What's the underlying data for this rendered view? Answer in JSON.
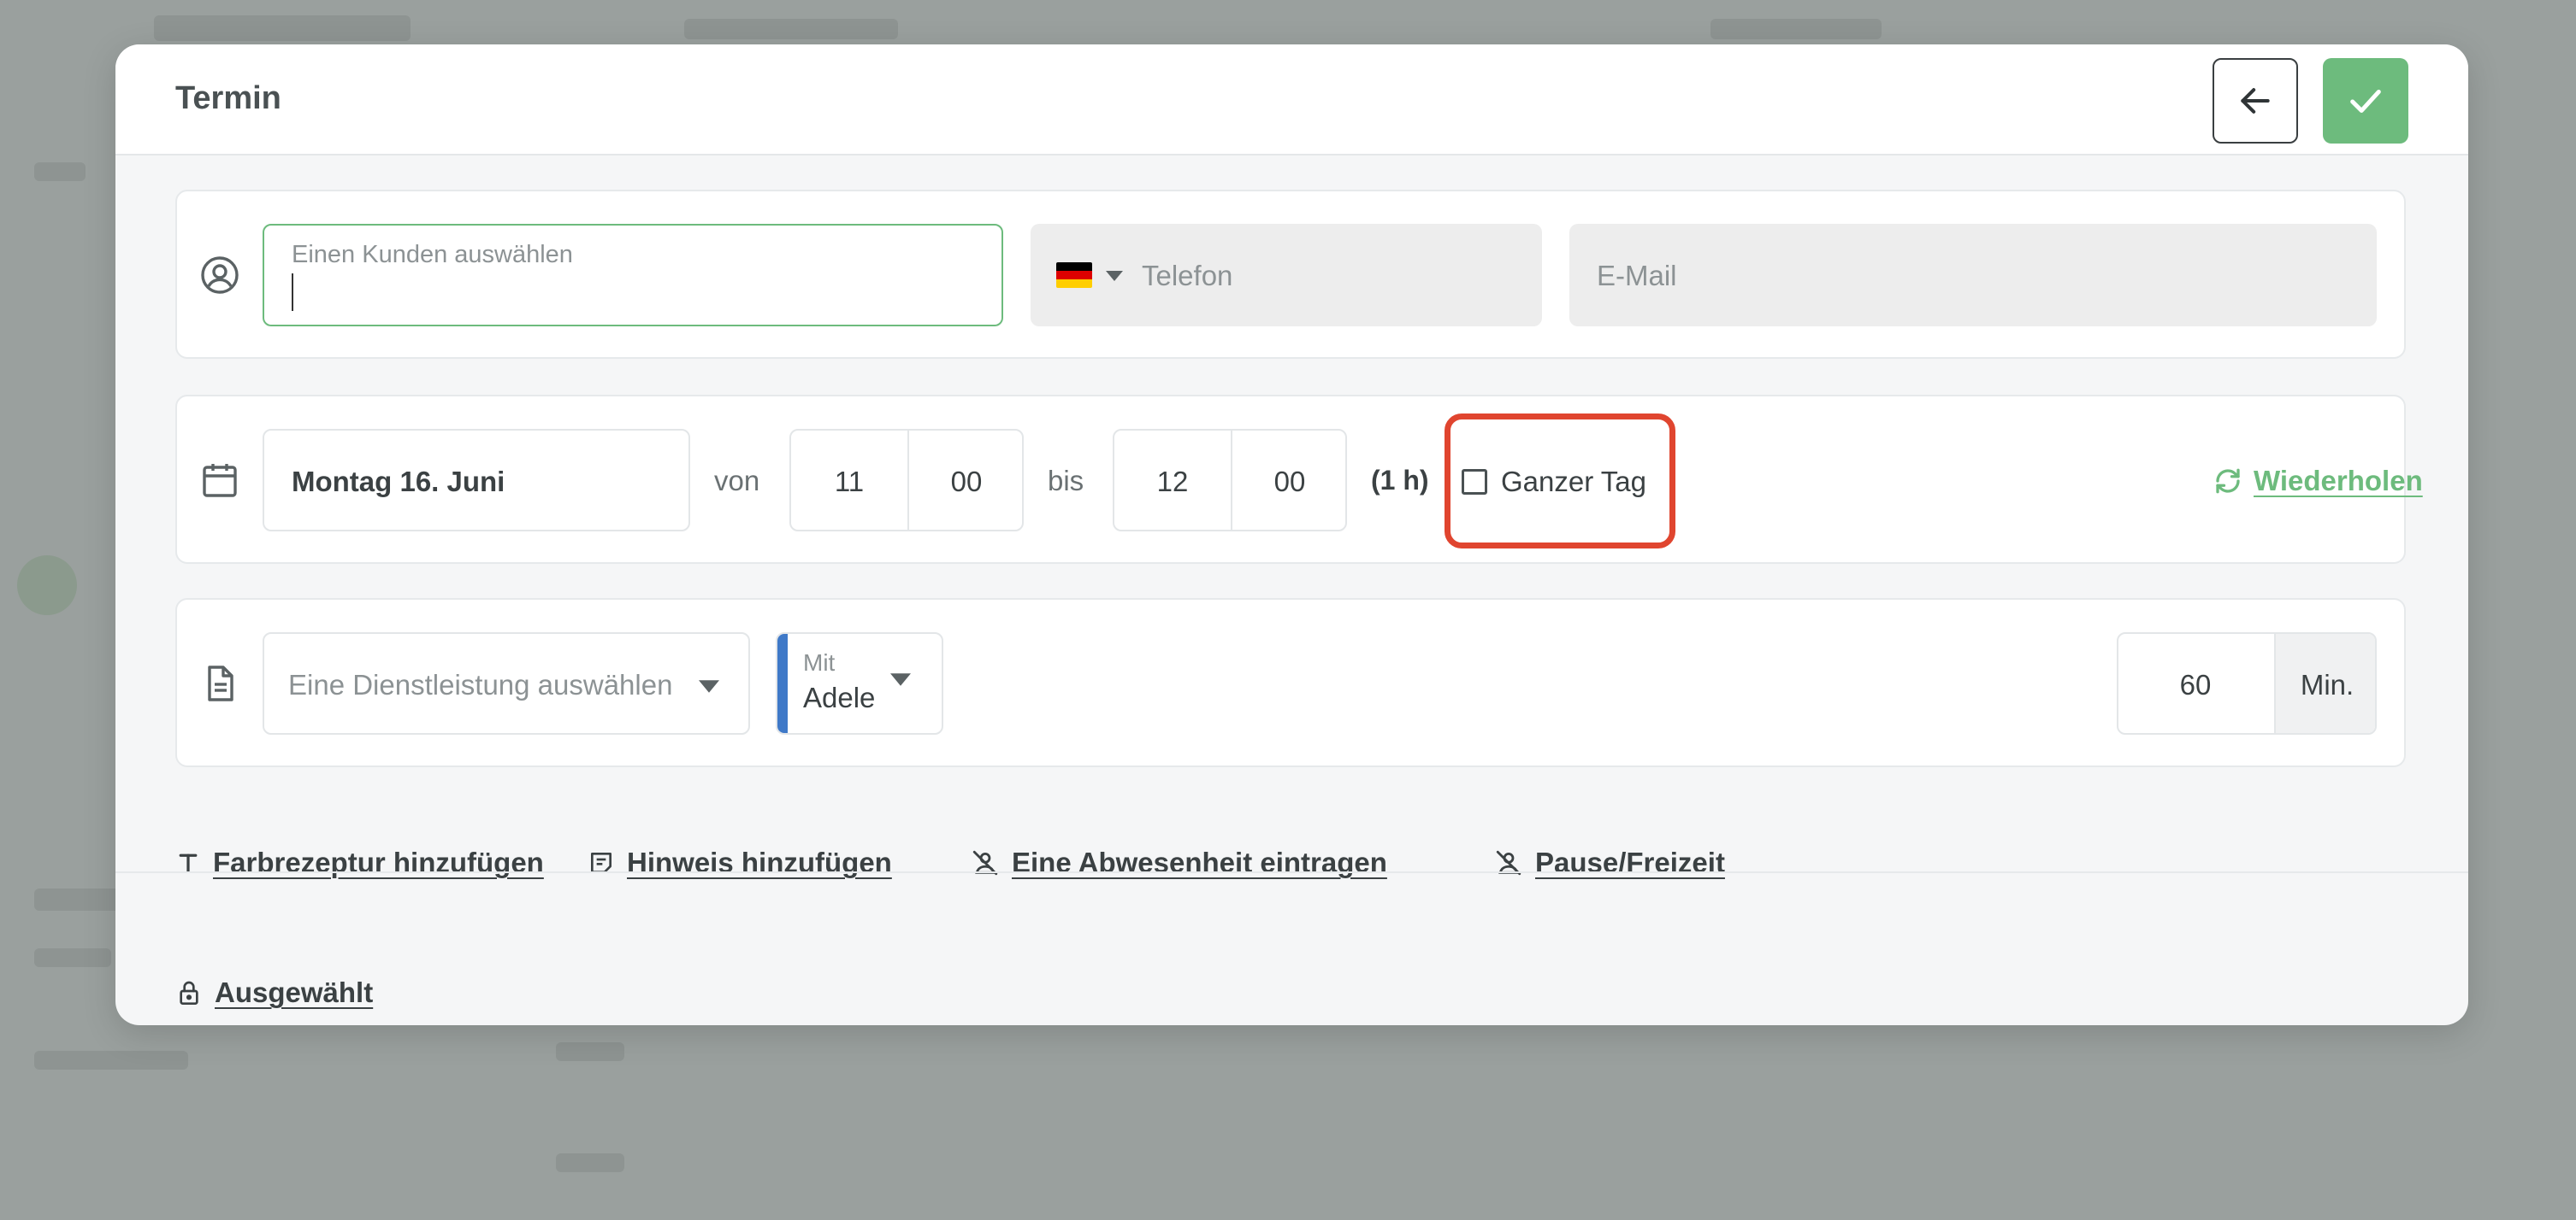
{
  "modal": {
    "title": "Termin"
  },
  "customer": {
    "placeholder": "Einen Kunden auswählen",
    "phone_placeholder": "Telefon",
    "email_placeholder": "E-Mail"
  },
  "schedule": {
    "date": "Montag 16. Juni",
    "from_label": "von",
    "from_hour": "11",
    "from_minute": "00",
    "to_label": "bis",
    "to_hour": "12",
    "to_minute": "00",
    "duration": "(1 h)",
    "all_day_label": "Ganzer Tag",
    "repeat_label": "Wiederholen"
  },
  "service": {
    "placeholder": "Eine Dienstleistung auswählen",
    "staff_caption": "Mit",
    "staff_name": "Adele",
    "minutes_value": "60",
    "minutes_unit": "Min."
  },
  "actions": {
    "color_recipe": "Farbrezeptur hinzufügen",
    "add_note": "Hinweis hinzufügen",
    "absence": "Eine Abwesenheit eintragen",
    "pause": "Pause/Freizeit"
  },
  "footer": {
    "selected_label": "Ausgewählt"
  },
  "colors": {
    "accent_green": "#6dbb7d",
    "highlight_red": "#e0452f",
    "staff_blue": "#3f79c8"
  }
}
